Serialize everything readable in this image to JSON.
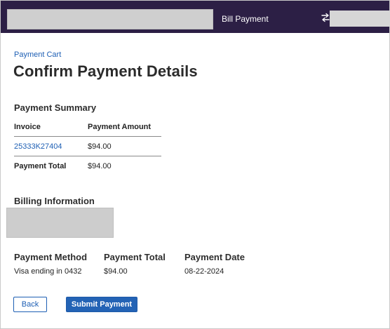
{
  "header": {
    "app_title": "Bill Payment",
    "swap_icon": "swap-arrows-icon",
    "background": "#2c1f45"
  },
  "breadcrumb": "Payment Cart",
  "page_title": "Confirm Payment Details",
  "summary": {
    "heading": "Payment Summary",
    "columns": [
      "Invoice",
      "Payment Amount"
    ],
    "rows": [
      {
        "invoice": "25333K27404",
        "amount": "$94.00"
      }
    ],
    "total_label": "Payment Total",
    "total_value": "$94.00"
  },
  "billing": {
    "heading": "Billing Information"
  },
  "details": [
    {
      "label": "Payment Method",
      "value": "Visa ending in 0432"
    },
    {
      "label": "Payment Total",
      "value": "$94.00"
    },
    {
      "label": "Payment Date",
      "value": "08-22-2024"
    }
  ],
  "actions": {
    "back_label": "Back",
    "submit_label": "Submit Payment"
  },
  "colors": {
    "link": "#1e5fb4",
    "primary_button": "#2363b5"
  }
}
